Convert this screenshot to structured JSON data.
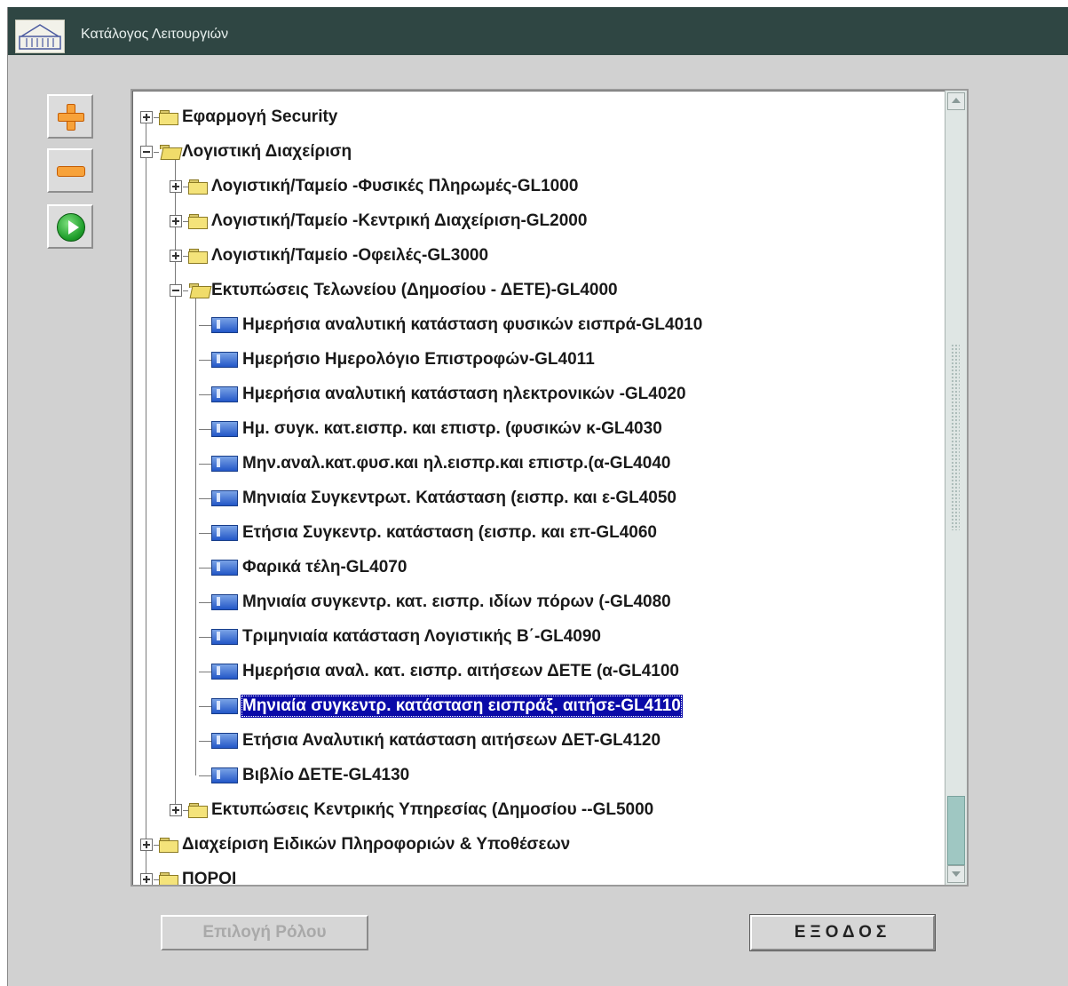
{
  "window": {
    "title": "Κατάλογος Λειτουργιών"
  },
  "side_buttons": [
    {
      "name": "plus-icon"
    },
    {
      "name": "minus-icon"
    },
    {
      "name": "play-icon"
    }
  ],
  "tree": {
    "items": [
      {
        "label": "Εφαρμογή Security",
        "state": "collapsed",
        "level": 0
      },
      {
        "label": "Λογιστική Διαχείριση",
        "state": "expanded",
        "level": 0
      },
      {
        "label": "Λογιστική/Ταμείο -Φυσικές Πληρωμές-GL1000",
        "state": "collapsed",
        "level": 1
      },
      {
        "label": "Λογιστική/Ταμείο -Κεντρική Διαχείριση-GL2000",
        "state": "collapsed",
        "level": 1
      },
      {
        "label": "Λογιστική/Ταμείο -Οφειλές-GL3000",
        "state": "collapsed",
        "level": 1
      },
      {
        "label": "Εκτυπώσεις  Τελωνείου (Δημοσίου - ΔΕΤΕ)-GL4000",
        "state": "expanded",
        "level": 1
      },
      {
        "label": "Ημερήσια αναλυτική κατάσταση φυσικών εισπρά-GL4010",
        "state": "leaf",
        "level": 2
      },
      {
        "label": "Ημερήσιο Ημερολόγιο Επιστροφών-GL4011",
        "state": "leaf",
        "level": 2
      },
      {
        "label": "Ημερήσια αναλυτική κατάσταση ηλεκτρονικών  -GL4020",
        "state": "leaf",
        "level": 2
      },
      {
        "label": "Ημ. συγκ. κατ.εισπρ. και επιστρ. (φυσικών κ-GL4030",
        "state": "leaf",
        "level": 2
      },
      {
        "label": "Μην.αναλ.κατ.φυσ.και ηλ.εισπρ.και επιστρ.(α-GL4040",
        "state": "leaf",
        "level": 2
      },
      {
        "label": "Μηνιαία Συγκεντρωτ. Κατάσταση (εισπρ. και ε-GL4050",
        "state": "leaf",
        "level": 2
      },
      {
        "label": "Ετήσια Συγκεντρ. κατάσταση (εισπρ. και επ-GL4060",
        "state": "leaf",
        "level": 2
      },
      {
        "label": "Φαρικά τέλη-GL4070",
        "state": "leaf",
        "level": 2
      },
      {
        "label": "Μηνιαία συγκεντρ. κατ. εισπρ. ιδίων πόρων (-GL4080",
        "state": "leaf",
        "level": 2
      },
      {
        "label": "Τριμηνιαία κατάσταση Λογιστικής Β΄-GL4090",
        "state": "leaf",
        "level": 2
      },
      {
        "label": "Ημερήσια αναλ. κατ. εισπρ. αιτήσεων ΔΕΤΕ (α-GL4100",
        "state": "leaf",
        "level": 2
      },
      {
        "label": "Μηνιαία συγκεντρ. κατάσταση εισπράξ. αιτήσε-GL4110",
        "state": "leaf",
        "level": 2,
        "selected": true
      },
      {
        "label": "Ετήσια Αναλυτική κατάσταση αιτήσεων ΔΕΤ-GL4120",
        "state": "leaf",
        "level": 2
      },
      {
        "label": "Βιβλίο ΔΕΤΕ-GL4130",
        "state": "leaf",
        "level": 2
      },
      {
        "label": "Εκτυπώσεις  Κεντρικής Υπηρεσίας (Δημοσίου --GL5000",
        "state": "collapsed",
        "level": 1
      },
      {
        "label": "Διαχείριση Ειδικών Πληροφοριών & Υποθέσεων",
        "state": "collapsed",
        "level": 0
      },
      {
        "label": "ΠΟΡΟΙ",
        "state": "collapsed",
        "level": 0
      }
    ]
  },
  "buttons": {
    "select_role": "Επιλογή Ρόλου",
    "exit": "ΕΞΟΔΟΣ"
  }
}
